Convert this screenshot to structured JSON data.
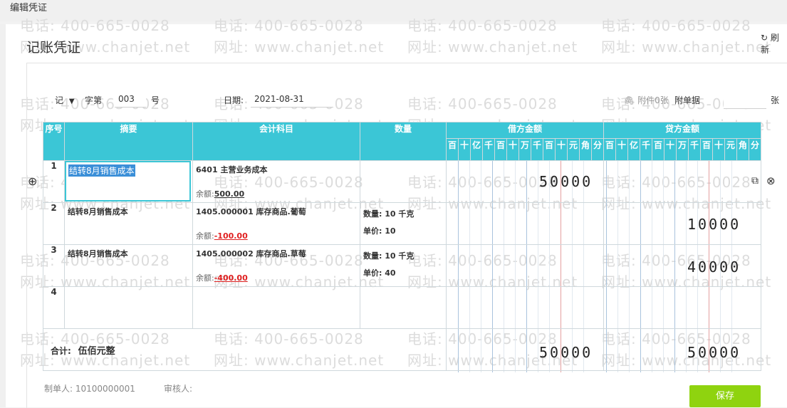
{
  "window": {
    "title": "编辑凭证"
  },
  "page": {
    "title": "记账凭证",
    "refresh_label": "刷新"
  },
  "watermark": {
    "phone": "电话: 400-665-0028",
    "site": "网址: www.chanjet.net"
  },
  "voucher_header": {
    "type_value": "记",
    "word_label": "字第",
    "number_value": "003",
    "number_suffix": "号",
    "date_label": "日期:",
    "date_value": "2021-08-31",
    "attachment_label": "附件0张",
    "attach_doc_label": "附单据",
    "attach_doc_value": "",
    "attach_unit": "张"
  },
  "table": {
    "headers": {
      "seq": "序号",
      "summary": "摘要",
      "account": "会计科目",
      "quantity": "数量",
      "debit": "借方金额",
      "credit": "贷方金额"
    },
    "digit_headers": [
      "百",
      "十",
      "亿",
      "千",
      "百",
      "十",
      "万",
      "千",
      "百",
      "十",
      "元",
      "角",
      "分"
    ],
    "rows": [
      {
        "no": "1",
        "summary": "结转8月销售成本",
        "account": "6401 主营业务成本",
        "balance_label": "余额:",
        "balance": "500.00",
        "qty": "",
        "price": "",
        "debit": "50000",
        "credit": ""
      },
      {
        "no": "2",
        "summary": "结转8月销售成本",
        "account": "1405.000001 库存商品.葡萄",
        "balance_label": "余额:",
        "balance": "-100.00",
        "qty": "数量: 10 千克",
        "price": "单价: 10",
        "debit": "",
        "credit": "10000"
      },
      {
        "no": "3",
        "summary": "结转8月销售成本",
        "account": "1405.000002 库存商品.草莓",
        "balance_label": "余额:",
        "balance": "-400.00",
        "qty": "数量: 10 千克",
        "price": "单价: 40",
        "debit": "",
        "credit": "40000"
      },
      {
        "no": "4",
        "summary": "",
        "account": "",
        "balance_label": "",
        "balance": "",
        "qty": "",
        "price": "",
        "debit": "",
        "credit": ""
      }
    ],
    "total": {
      "label": "合计:",
      "words": "伍佰元整",
      "debit": "50000",
      "credit": "50000"
    }
  },
  "footer": {
    "maker_label": "制单人:",
    "maker_value": "10100000001",
    "reviewer_label": "审核人:",
    "save_label": "保存"
  }
}
